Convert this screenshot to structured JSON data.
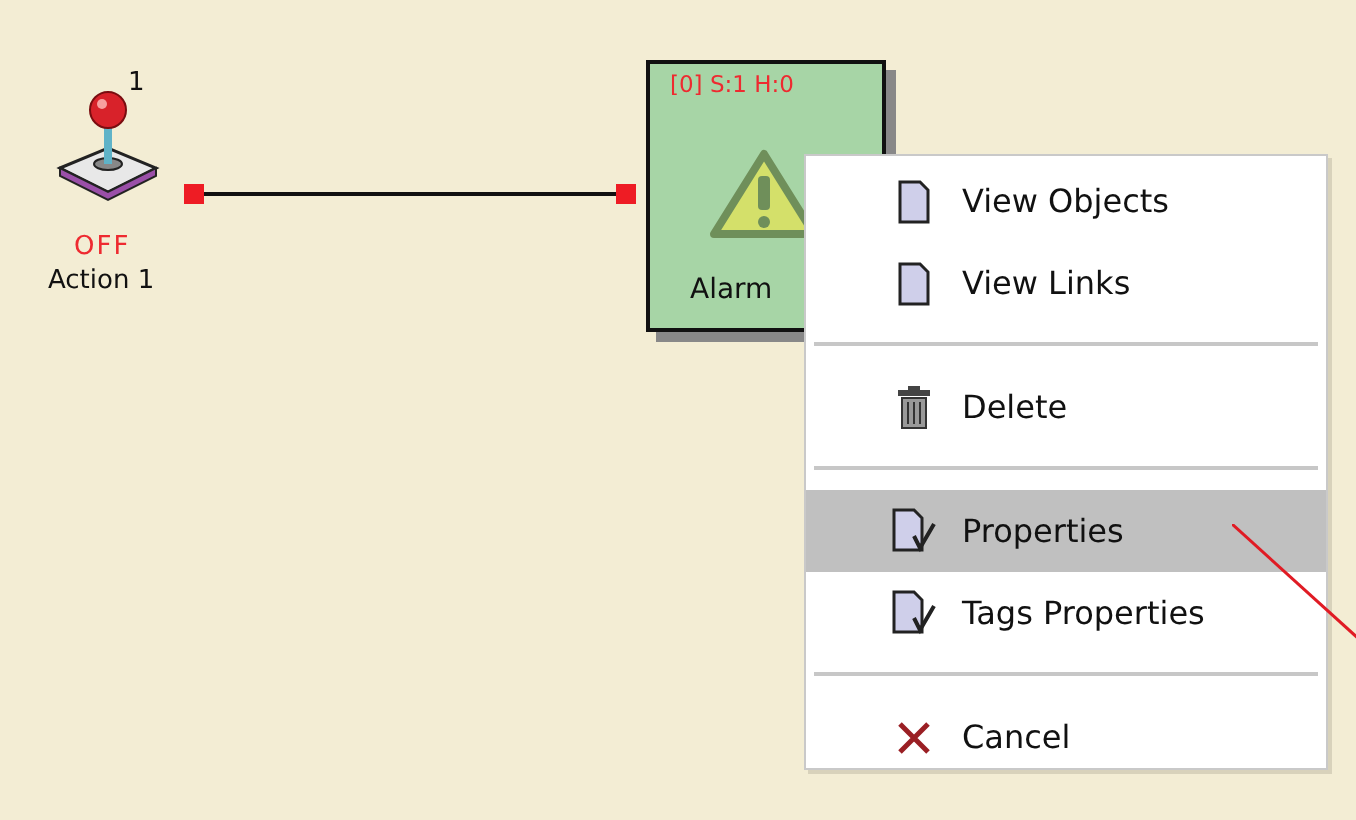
{
  "nodes": [
    {
      "kind": "joystick",
      "index": "1",
      "state": "OFF",
      "label": "Action 1"
    },
    {
      "kind": "alarm",
      "status": "[0] S:1 H:0",
      "label": "Alarm"
    }
  ],
  "context_menu": {
    "groups": [
      {
        "items": [
          {
            "kind": "document",
            "label": "View Objects",
            "selected": false
          },
          {
            "kind": "document",
            "label": "View Links",
            "selected": false
          }
        ]
      },
      {
        "items": [
          {
            "kind": "trash",
            "label": "Delete",
            "selected": false
          }
        ]
      },
      {
        "items": [
          {
            "kind": "properties",
            "label": "Properties",
            "selected": true
          },
          {
            "kind": "properties",
            "label": "Tags Properties",
            "selected": false
          }
        ]
      },
      {
        "items": [
          {
            "kind": "cancel",
            "label": "Cancel",
            "selected": false
          }
        ]
      }
    ]
  }
}
